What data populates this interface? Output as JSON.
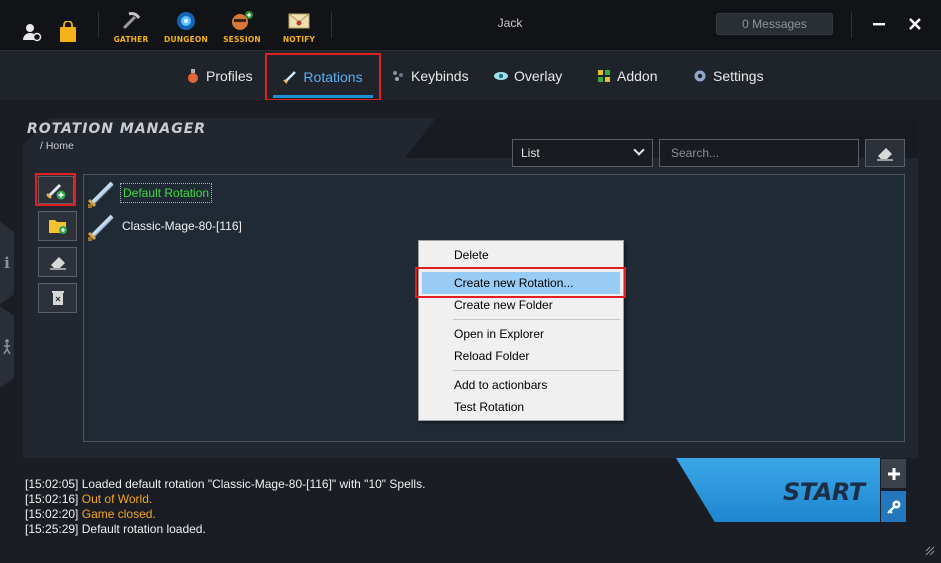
{
  "titlebar": {
    "username": "Jack",
    "messages": "0 Messages",
    "buttons": [
      {
        "label": "GATHER"
      },
      {
        "label": "DUNGEON"
      },
      {
        "label": "SESSION"
      },
      {
        "label": "NOTIFY"
      }
    ]
  },
  "tabs": [
    {
      "label": "Profiles"
    },
    {
      "label": "Rotations"
    },
    {
      "label": "Keybinds"
    },
    {
      "label": "Overlay"
    },
    {
      "label": "Addon"
    },
    {
      "label": "Settings"
    }
  ],
  "rotation_manager": {
    "title": "ROTATION MANAGER",
    "breadcrumb": "/  Home",
    "view_select": "List",
    "search_placeholder": "Search..."
  },
  "tree": {
    "items": [
      {
        "label": "Default Rotation",
        "color": "#3ddc3d"
      },
      {
        "label": "Classic-Mage-80-[116]"
      }
    ]
  },
  "context_menu": {
    "items": [
      "Delete",
      "Create new Rotation...",
      "Create new Folder",
      "Open in Explorer",
      "Reload Folder",
      "Add to actionbars",
      "Test Rotation"
    ]
  },
  "log": [
    {
      "time": "[15:02:05]",
      "message": "Loaded default rotation \"Classic-Mage-80-[116]\" with \"10\" Spells.",
      "color": "#f0f0f0"
    },
    {
      "time": "[15:02:16]",
      "message": "Out of World.",
      "color": "#f5a623"
    },
    {
      "time": "[15:02:20]",
      "message": "Game closed.",
      "color": "#f5a623"
    },
    {
      "time": "[15:25:29]",
      "message": "Default rotation loaded.",
      "color": "#f0f0f0"
    }
  ],
  "start_label": "START",
  "colors": {
    "accent": "#1e90d6",
    "highlight_box": "#e02020",
    "menu_selected": "#99ccf4"
  }
}
